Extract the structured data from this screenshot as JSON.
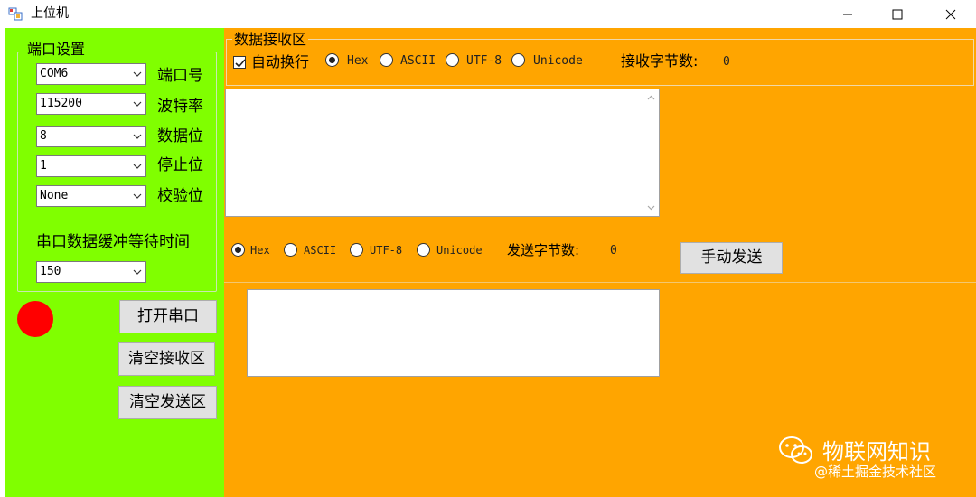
{
  "window": {
    "title": "上位机",
    "minimize_glyph": "–",
    "maximize_glyph": "□",
    "close_glyph": "✕"
  },
  "port_settings": {
    "group_title": "端口设置",
    "fields": [
      {
        "value": "COM6",
        "label": "端口号"
      },
      {
        "value": "115200",
        "label": "波特率"
      },
      {
        "value": "8",
        "label": "数据位"
      },
      {
        "value": "1",
        "label": "停止位"
      },
      {
        "value": "None",
        "label": "校验位"
      }
    ],
    "buffer_wait_label": "串口数据缓冲等待时间",
    "buffer_wait_value": "150"
  },
  "status": {
    "led_color": "#ff0000"
  },
  "buttons": {
    "open_port": "打开串口",
    "clear_receive": "清空接收区",
    "clear_send": "清空发送区",
    "manual_send": "手动发送"
  },
  "receive": {
    "group_title": "数据接收区",
    "auto_wrap_label": "自动换行",
    "auto_wrap_checked": true,
    "encodings": [
      "Hex",
      "ASCII",
      "UTF-8",
      "Unicode"
    ],
    "selected_encoding": "Hex",
    "bytes_label": "接收字节数:",
    "bytes_value": "0",
    "content": ""
  },
  "send": {
    "encodings": [
      "Hex",
      "ASCII",
      "UTF-8",
      "Unicode"
    ],
    "selected_encoding": "Hex",
    "bytes_label": "发送字节数:",
    "bytes_value": "0",
    "content": ""
  },
  "watermark": {
    "title": "物联网知识",
    "subtitle": "@稀土掘金技术社区"
  },
  "colors": {
    "left_panel": "#80ff00",
    "right_panel": "#ffa500",
    "button_face": "#e1e1e1"
  }
}
